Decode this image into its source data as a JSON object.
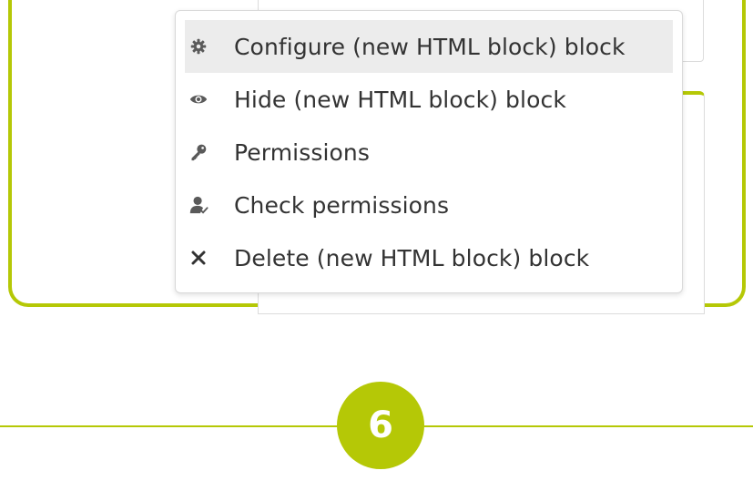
{
  "context_menu": {
    "items": [
      {
        "label": "Configure (new HTML block) block",
        "icon": "gear-icon"
      },
      {
        "label": "Hide (new HTML block) block",
        "icon": "eye-icon"
      },
      {
        "label": "Permissions",
        "icon": "key-icon"
      },
      {
        "label": "Check permissions",
        "icon": "user-check-icon"
      },
      {
        "label": "Delete (new HTML block) block",
        "icon": "close-icon"
      }
    ],
    "highlighted_index": 0
  },
  "step": {
    "number": "6"
  },
  "colors": {
    "accent": "#b5c806",
    "menu_text": "#333333",
    "icon": "#5a5a5a",
    "highlight": "#ececec"
  }
}
